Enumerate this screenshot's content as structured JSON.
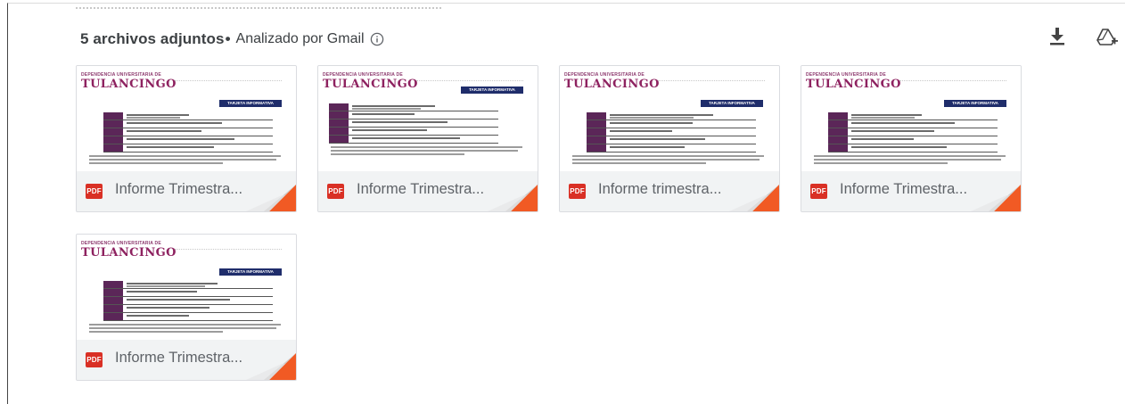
{
  "header": {
    "attachments_count": "5 archivos adjuntos",
    "separator": "•",
    "scan_label": "Analizado por Gmail"
  },
  "icons": {
    "info": "info-icon",
    "download_all": "download-icon",
    "add_to_drive": "add-to-drive-icon"
  },
  "colors": {
    "pdf_red": "#d93025",
    "corner_orange": "#f15a24",
    "logo_magenta": "#8e2260",
    "doc_navy": "#1f2d6b"
  },
  "attachments": [
    {
      "type_badge": "PDF",
      "name": "Informe Trimestra...",
      "doc_logo_top": "DEPENDENCIA UNIVERSITARIA DE",
      "doc_logo": "TULANCINGO",
      "doc_tag": "TARJETA INFORMATIVA"
    },
    {
      "type_badge": "PDF",
      "name": "Informe Trimestra...",
      "doc_logo_top": "DEPENDENCIA UNIVERSITARIA DE",
      "doc_logo": "TULANCINGO",
      "doc_tag": "TARJETA INFORMATIVA"
    },
    {
      "type_badge": "PDF",
      "name": "Informe trimestra...",
      "doc_logo_top": "DEPENDENCIA UNIVERSITARIA DE",
      "doc_logo": "TULANCINGO",
      "doc_tag": "TARJETA INFORMATIVA"
    },
    {
      "type_badge": "PDF",
      "name": "Informe Trimestra...",
      "doc_logo_top": "DEPENDENCIA UNIVERSITARIA DE",
      "doc_logo": "TULANCINGO",
      "doc_tag": "TARJETA INFORMATIVA"
    },
    {
      "type_badge": "PDF",
      "name": "Informe Trimestra...",
      "doc_logo_top": "DEPENDENCIA UNIVERSITARIA DE",
      "doc_logo": "TULANCINGO",
      "doc_tag": "TARJETA INFORMATIVA"
    }
  ]
}
